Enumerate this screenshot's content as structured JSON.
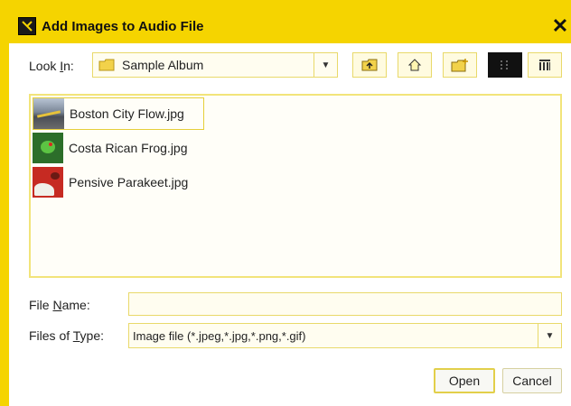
{
  "window": {
    "title": "Add Images to Audio File",
    "close_glyph": "✕"
  },
  "look_in": {
    "label_pre": "Look ",
    "label_mnemonic": "I",
    "label_post": "n:",
    "value": "Sample Album",
    "icon": "folder-icon"
  },
  "toolbar": {
    "buttons": [
      {
        "name": "up-folder-icon"
      },
      {
        "name": "home-icon"
      },
      {
        "name": "new-folder-icon"
      },
      {
        "name": "list-view-icon",
        "active": true
      },
      {
        "name": "details-view-icon",
        "active": false
      }
    ]
  },
  "files": [
    {
      "name": "Boston City Flow.jpg",
      "selected": true,
      "thumb": "city-thumbnail"
    },
    {
      "name": "Costa Rican Frog.jpg",
      "selected": false,
      "thumb": "frog-thumbnail"
    },
    {
      "name": "Pensive Parakeet.jpg",
      "selected": false,
      "thumb": "parakeet-thumbnail"
    }
  ],
  "file_name": {
    "label_pre": "File ",
    "label_mnemonic": "N",
    "label_post": "ame:",
    "value": ""
  },
  "file_type": {
    "label_pre": "Files of ",
    "label_mnemonic": "T",
    "label_post": "ype:",
    "value": "Image file (*.jpeg,*.jpg,*.png,*.gif)"
  },
  "buttons": {
    "open": "Open",
    "cancel": "Cancel"
  },
  "colors": {
    "accent": "#f5d400",
    "border": "#e9d96a"
  }
}
